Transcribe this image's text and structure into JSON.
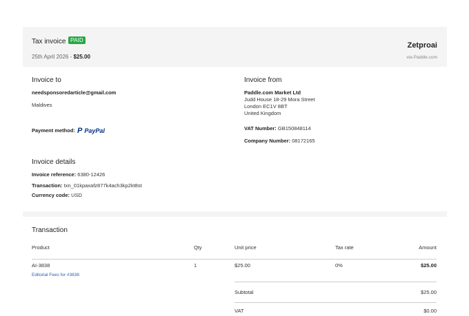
{
  "header": {
    "title": "Tax invoice",
    "badge": "PAID",
    "date": "25th April 2026",
    "separator": " - ",
    "amount": "$25.00",
    "seller": "Zetproai",
    "via": "via Paddle.com",
    "badge_color": "#27a844"
  },
  "invoice_to": {
    "title": "Invoice to",
    "email": "needsponsoredarticle@gmail.com",
    "country": "Maldives",
    "payment_label": "Payment method:",
    "payment_method": "PayPal",
    "payment_icon": "paypal-icon"
  },
  "invoice_from": {
    "title": "Invoice from",
    "company": "Paddle.com Market Ltd",
    "address1": "Judd House 18-29 Mora Street",
    "address2": "London EC1V 8BT",
    "address3": "United Kingdom",
    "vat_label": "VAT Number:",
    "vat_value": "GB150848114",
    "company_no_label": "Company Number:",
    "company_no_value": "08172165"
  },
  "details": {
    "title": "Invoice details",
    "ref_label": "Invoice reference:",
    "ref_value": "6380-12426",
    "txn_label": "Transaction:",
    "txn_value": "txn_01kpaxafz877k4ach3kp2kt8st",
    "currency_label": "Currency code:",
    "currency_value": "USD"
  },
  "transaction": {
    "title": "Transaction",
    "columns": [
      "Product",
      "Qty",
      "Unit price",
      "Tax rate",
      "Amount"
    ],
    "rows": [
      {
        "product": "AI-3838",
        "description": "Editorial Fees for #3838",
        "qty": "1",
        "unit_price": "$25.00",
        "tax_rate": "0%",
        "amount": "$25.00"
      }
    ],
    "subtotal_label": "Subtotal",
    "subtotal_value": "$25.00",
    "vat_label": "VAT",
    "vat_value": "$0.00"
  }
}
